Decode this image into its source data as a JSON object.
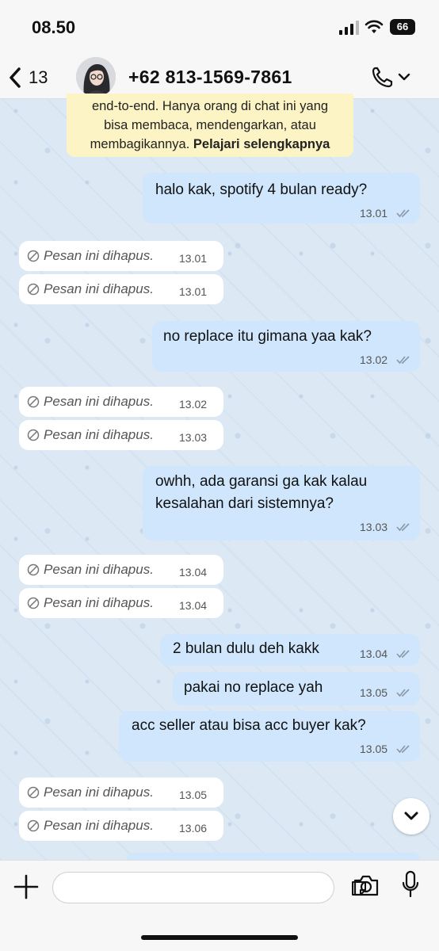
{
  "status_bar": {
    "time": "08.50",
    "battery": "66"
  },
  "header": {
    "back_count": "13",
    "contact_name": "+62 813-1569-7861"
  },
  "notice": {
    "line1": "end-to-end. Hanya orang di chat ini yang",
    "line2": "bisa membaca, mendengarkan, atau",
    "line3": "membagikannya.",
    "link": "Pelajari selengkapnya"
  },
  "messages": {
    "m1": {
      "text": "halo kak, spotify 4 bulan ready?",
      "time": "13.01"
    },
    "d1": {
      "text": "Pesan ini dihapus.",
      "time": "13.01"
    },
    "d2": {
      "text": "Pesan ini dihapus.",
      "time": "13.01"
    },
    "m2": {
      "text": "no replace itu gimana yaa kak?",
      "time": "13.02"
    },
    "d3": {
      "text": "Pesan ini dihapus.",
      "time": "13.02"
    },
    "d4": {
      "text": "Pesan ini dihapus.",
      "time": "13.03"
    },
    "m3": {
      "line1": "owhh, ada garansi ga kak kalau",
      "line2": "kesalahan dari sistemnya?",
      "time": "13.03"
    },
    "d5": {
      "text": "Pesan ini dihapus.",
      "time": "13.04"
    },
    "d6": {
      "text": "Pesan ini dihapus.",
      "time": "13.04"
    },
    "m4": {
      "text": "2 bulan dulu deh kakk",
      "time": "13.04"
    },
    "m5": {
      "text": "pakai no replace yah",
      "time": "13.05"
    },
    "m6": {
      "text": "acc seller atau bisa acc buyer kak?",
      "time": "13.05"
    },
    "d7": {
      "text": "Pesan ini dihapus.",
      "time": "13.05"
    },
    "d8": {
      "text": "Pesan ini dihapus.",
      "time": "13.06"
    }
  },
  "input": {
    "placeholder": ""
  },
  "colors": {
    "outgoing_bubble": "#cfe6fc",
    "incoming_bubble": "#ffffff",
    "notice_bg": "#fdf4c5",
    "read_ticks": "#8a97a6"
  },
  "icons": [
    "back-chevron-icon",
    "phone-icon",
    "chevron-down-icon",
    "double-check-icon",
    "deleted-icon",
    "plus-icon",
    "sticker-icon",
    "camera-icon",
    "microphone-icon",
    "scroll-down-icon"
  ]
}
